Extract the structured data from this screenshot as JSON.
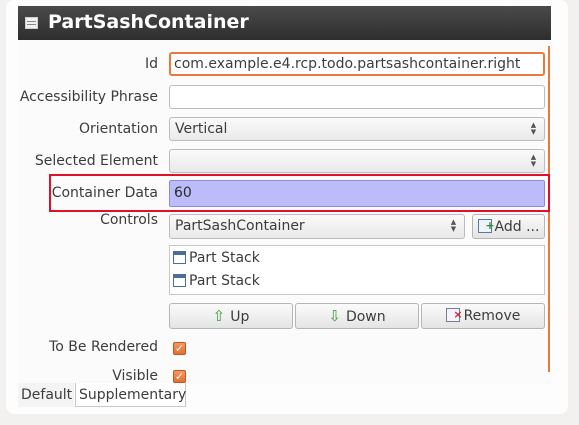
{
  "header": {
    "title": "PartSashContainer",
    "icon": "window-icon"
  },
  "form": {
    "id": {
      "label": "Id",
      "value": "com.example.e4.rcp.todo.partsashcontainer.right"
    },
    "accessibility": {
      "label": "Accessibility Phrase",
      "value": ""
    },
    "orientation": {
      "label": "Orientation",
      "value": "Vertical"
    },
    "selected_element": {
      "label": "Selected Element",
      "value": ""
    },
    "container_data": {
      "label": "Container Data",
      "value": "60"
    },
    "controls": {
      "label": "Controls",
      "combo_value": "PartSashContainer",
      "add_label": "Add ...",
      "items": [
        "Part Stack",
        "Part Stack"
      ],
      "up_label": "Up",
      "down_label": "Down",
      "remove_label": "Remove"
    },
    "to_be_rendered": {
      "label": "To Be Rendered",
      "checked": true
    },
    "visible": {
      "label": "Visible",
      "checked": true
    }
  },
  "tabs": [
    "Default",
    "Supplementary"
  ],
  "colors": {
    "accent": "#e8793c",
    "highlight": "#e0102a",
    "selection": "#bcbcfb"
  }
}
